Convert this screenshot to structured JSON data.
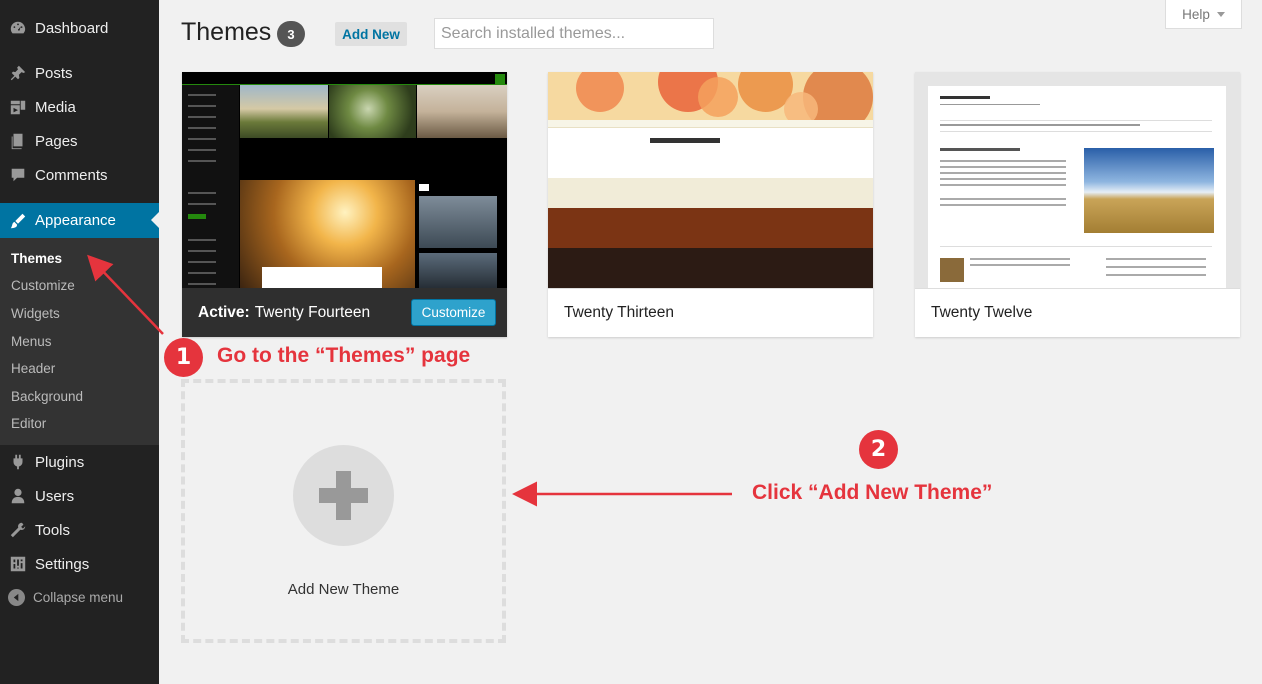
{
  "sidebar": {
    "items": [
      {
        "label": "Dashboard",
        "icon": "dashboard-icon"
      },
      {
        "label": "Posts",
        "icon": "pin-icon"
      },
      {
        "label": "Media",
        "icon": "media-icon"
      },
      {
        "label": "Pages",
        "icon": "pages-icon"
      },
      {
        "label": "Comments",
        "icon": "comment-icon"
      },
      {
        "label": "Appearance",
        "icon": "brush-icon"
      },
      {
        "label": "Plugins",
        "icon": "plug-icon"
      },
      {
        "label": "Users",
        "icon": "user-icon"
      },
      {
        "label": "Tools",
        "icon": "wrench-icon"
      },
      {
        "label": "Settings",
        "icon": "settings-icon"
      }
    ],
    "submenu": [
      "Themes",
      "Customize",
      "Widgets",
      "Menus",
      "Header",
      "Background",
      "Editor"
    ],
    "collapse_label": "Collapse menu"
  },
  "header": {
    "title": "Themes",
    "count": "3",
    "add_new_label": "Add New",
    "search_placeholder": "Search installed themes...",
    "help_label": "Help"
  },
  "themes": [
    {
      "active_prefix": "Active:",
      "name": "Twenty Fourteen",
      "customize_label": "Customize"
    },
    {
      "name": "Twenty Thirteen"
    },
    {
      "name": "Twenty Twelve"
    }
  ],
  "add_new_theme_label": "Add New Theme",
  "annotations": {
    "step1": {
      "number": "1",
      "text": "Go to the “Themes” page"
    },
    "step2": {
      "number": "2",
      "text": "Click “Add New Theme”"
    }
  },
  "colors": {
    "accent": "#0074a2",
    "annotation_red": "#e5343d",
    "sidebar_bg": "#222222"
  }
}
